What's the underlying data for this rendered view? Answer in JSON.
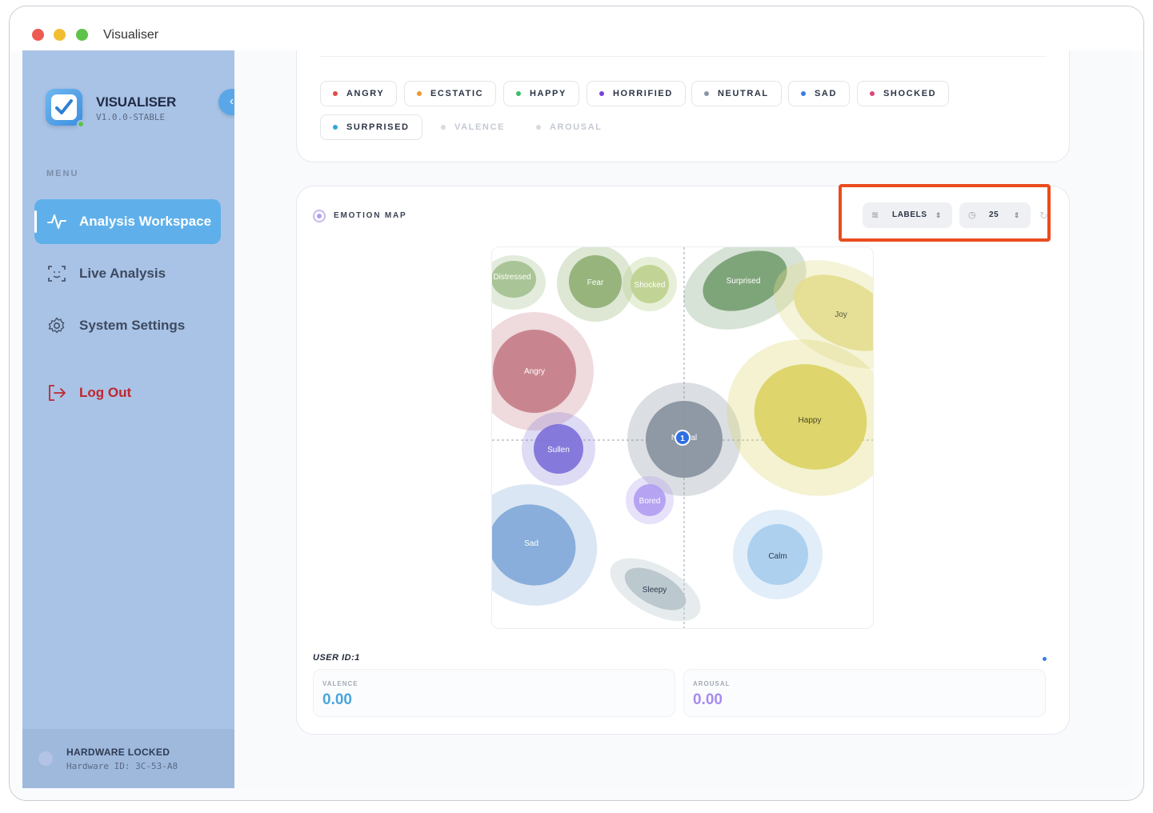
{
  "window": {
    "title": "Visualiser"
  },
  "brand": {
    "name": "VISUALISER",
    "version": "V1.0.0-STABLE"
  },
  "sidebar": {
    "menu_label": "MENU",
    "items": [
      {
        "label": "Analysis Workspace",
        "icon": "activity-icon",
        "active": true
      },
      {
        "label": "Live Analysis",
        "icon": "face-scan-icon",
        "active": false
      },
      {
        "label": "System Settings",
        "icon": "gear-icon",
        "active": false
      }
    ],
    "logout_label": "Log Out",
    "hardware": {
      "title": "HARDWARE LOCKED",
      "id": "Hardware ID: 3C-53-A8"
    }
  },
  "filters": {
    "chips": [
      {
        "label": "ANGRY",
        "color": "#e34a4a",
        "active": true
      },
      {
        "label": "ECSTATIC",
        "color": "#f0962e",
        "active": true
      },
      {
        "label": "HAPPY",
        "color": "#3dbb6a",
        "active": true
      },
      {
        "label": "HORRIFIED",
        "color": "#7a3fd9",
        "active": true
      },
      {
        "label": "NEUTRAL",
        "color": "#8a96a6",
        "active": true
      },
      {
        "label": "SAD",
        "color": "#3b7be6",
        "active": true
      },
      {
        "label": "SHOCKED",
        "color": "#e0447a",
        "active": true
      },
      {
        "label": "SURPRISED",
        "color": "#2fa6d8",
        "active": true
      },
      {
        "label": "VALENCE",
        "color": "#d6dae0",
        "active": false
      },
      {
        "label": "AROUSAL",
        "color": "#d6dae0",
        "active": false
      }
    ]
  },
  "emotion_map": {
    "title": "EMOTION MAP",
    "controls": {
      "labels_value": "LABELS",
      "count_value": "25"
    },
    "regions": [
      {
        "label": "Distressed",
        "fill": "#9fbd8a"
      },
      {
        "label": "Fear",
        "fill": "#8eae72"
      },
      {
        "label": "Shocked",
        "fill": "#bcd08e"
      },
      {
        "label": "Surprised",
        "fill": "#6f9a6a"
      },
      {
        "label": "Joy",
        "fill": "#e3de8f"
      },
      {
        "label": "Angry",
        "fill": "#c47b86"
      },
      {
        "label": "Neutral",
        "fill": "#8893a0"
      },
      {
        "label": "Happy",
        "fill": "#dcd366"
      },
      {
        "label": "Sullen",
        "fill": "#7b6fd8"
      },
      {
        "label": "Bored",
        "fill": "#b09cf0"
      },
      {
        "label": "Sad",
        "fill": "#7fa7d8"
      },
      {
        "label": "Calm",
        "fill": "#aacdee"
      },
      {
        "label": "Sleepy",
        "fill": "#b8c6cc"
      }
    ],
    "user_marker": {
      "label": "1"
    },
    "user_id_label": "USER ID:1",
    "valence": {
      "label": "VALENCE",
      "value": "0.00",
      "color": "#4aa6da"
    },
    "arousal": {
      "label": "AROUSAL",
      "value": "0.00",
      "color": "#a78bf0"
    }
  }
}
